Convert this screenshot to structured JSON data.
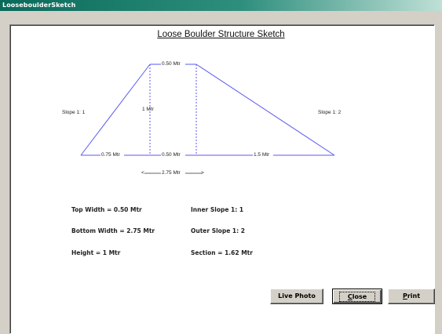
{
  "window": {
    "title": "LooseboulderSketch"
  },
  "sketch": {
    "title": "Loose Boulder Structure Sketch",
    "labels": {
      "top_width": "0.50 Mtr",
      "height": "1 Mtr",
      "left_base": "0.75 Mtr",
      "mid_base": "0.50 Mtr",
      "right_base": "1.5 Mtr",
      "total_width": "2.75 Mtr",
      "left_slope": "Slope 1: 1",
      "right_slope": "Slope 1: 2",
      "arrow_left": "<",
      "arrow_right": ">"
    },
    "line_color": "#5a5af0",
    "dash_color": "#5a5af0"
  },
  "stats": {
    "top_width": "Top Width = 0.50 Mtr",
    "bottom_width": "Bottom Width = 2.75 Mtr",
    "height": "Height = 1 Mtr",
    "inner_slope": "Inner Slope 1: 1",
    "outer_slope": "Outer Slope 1: 2",
    "section": "Section = 1.62 Mtr"
  },
  "buttons": {
    "live_photo": "Live Photo",
    "close_pre": "",
    "close_acc": "C",
    "close_post": "lose",
    "print_pre": "",
    "print_acc": "P",
    "print_post": "rint"
  }
}
